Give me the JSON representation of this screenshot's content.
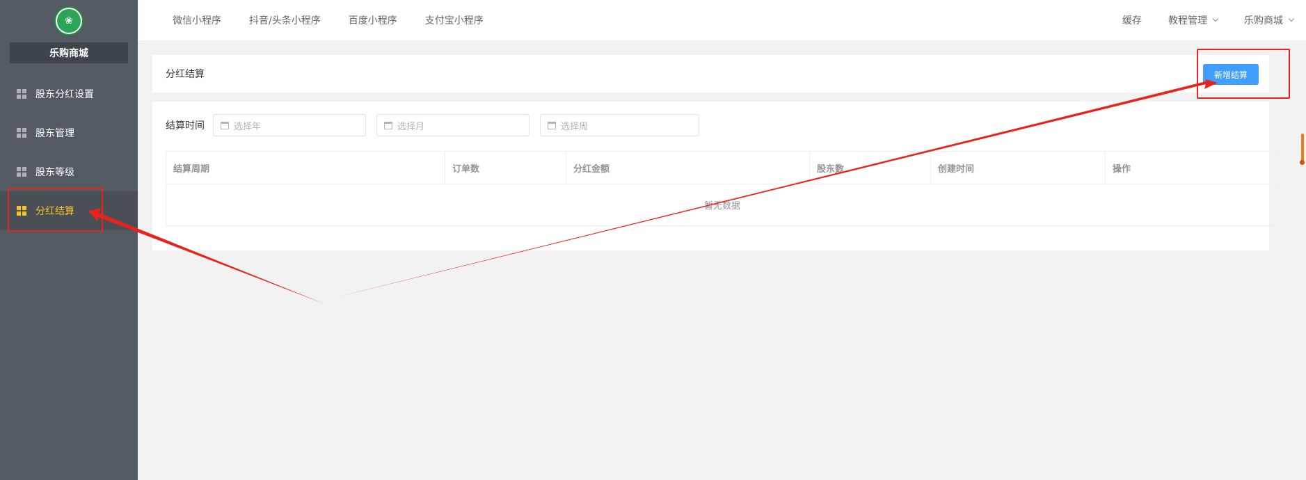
{
  "sidebar": {
    "logo_icon": "shop-logo",
    "shop_name": "乐购商城",
    "items": [
      {
        "label": "股东分红设置",
        "icon": "grid-icon",
        "active": false
      },
      {
        "label": "股东管理",
        "icon": "grid-icon",
        "active": false
      },
      {
        "label": "股东等级",
        "icon": "grid-icon",
        "active": false
      },
      {
        "label": "分红结算",
        "icon": "grid-icon",
        "active": true
      }
    ]
  },
  "topbar": {
    "tabs": [
      "微信小程序",
      "抖音/头条小程序",
      "百度小程序",
      "支付宝小程序"
    ],
    "cache": "缓存",
    "tutorial": "教程管理",
    "shop": "乐购商城"
  },
  "header": {
    "title": "分红结算",
    "new_button": "新增结算"
  },
  "filter": {
    "label": "结算时间",
    "year_placeholder": "选择年",
    "month_placeholder": "选择月",
    "week_placeholder": "选择周"
  },
  "table": {
    "columns": [
      "结算周期",
      "订单数",
      "分红金额",
      "股东数",
      "创建时间",
      "操作"
    ],
    "empty_text": "暂无数据"
  },
  "colors": {
    "sidebar_bg": "#545a61",
    "active_color": "#f5c42c",
    "primary": "#409eff",
    "annotation": "#e8231c"
  }
}
